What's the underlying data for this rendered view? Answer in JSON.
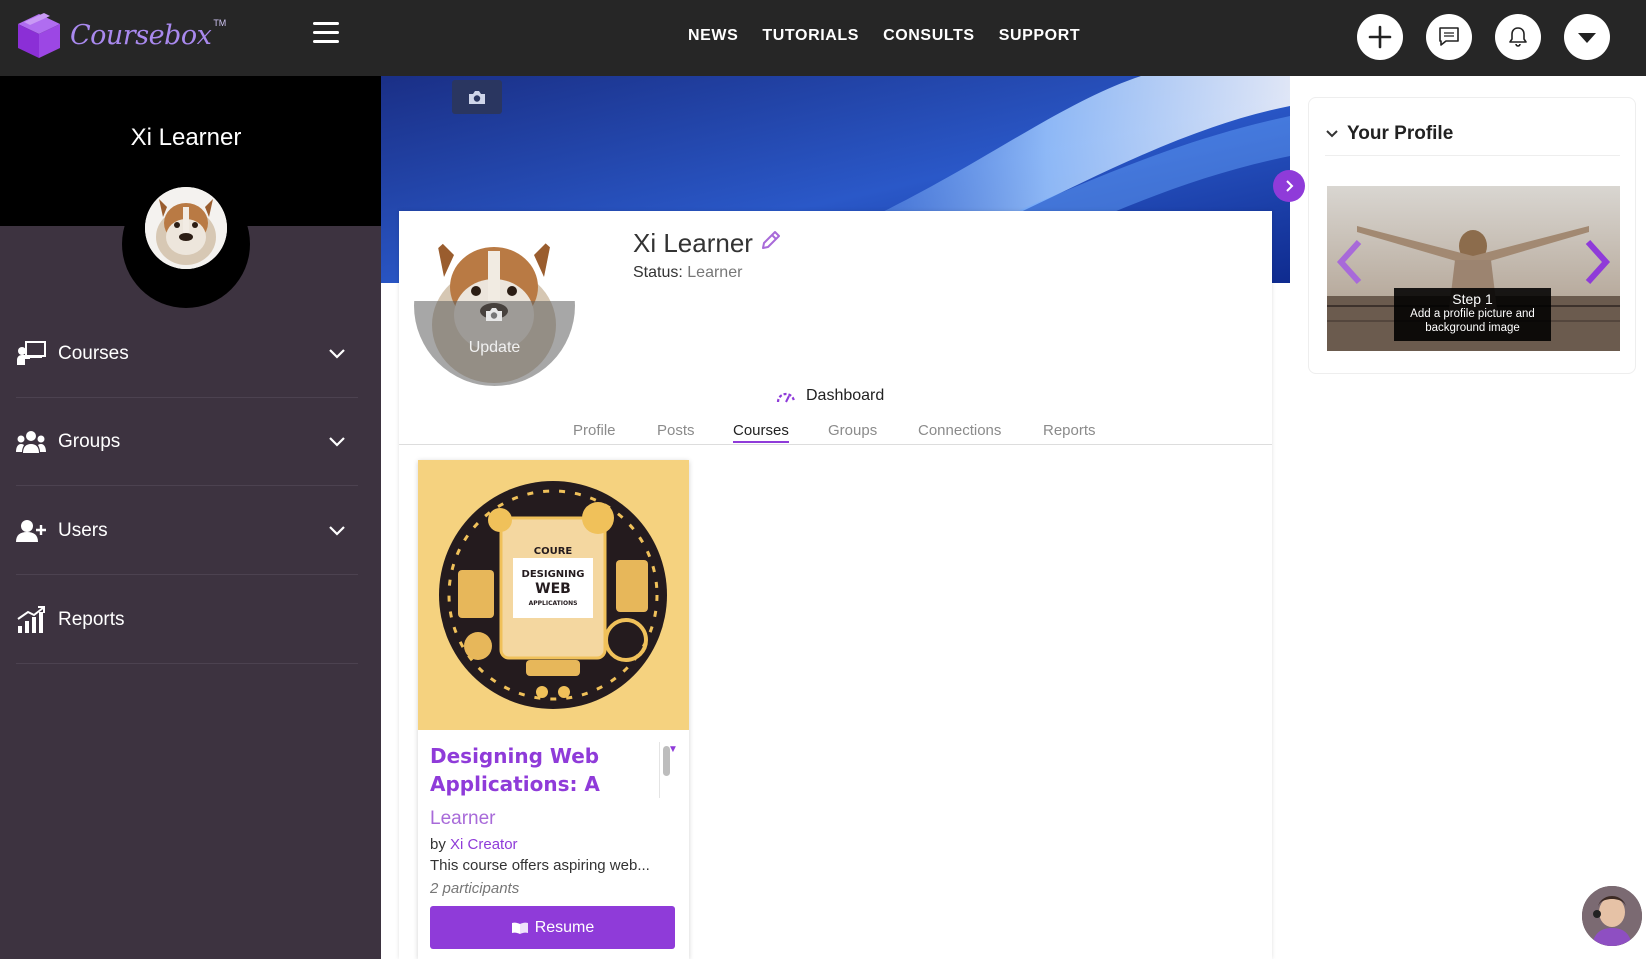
{
  "app": {
    "brand": "Coursebox",
    "trademark": "TM"
  },
  "topnav": {
    "items": [
      "NEWS",
      "TUTORIALS",
      "CONSULTS",
      "SUPPORT"
    ]
  },
  "header_icons": [
    "plus-icon",
    "chat-icon",
    "bell-icon",
    "dropdown-icon"
  ],
  "sidebar": {
    "user_name": "Xi Learner",
    "items": [
      {
        "label": "Courses",
        "icon": "courses-icon",
        "expandable": true
      },
      {
        "label": "Groups",
        "icon": "groups-icon",
        "expandable": true
      },
      {
        "label": "Users",
        "icon": "users-icon",
        "expandable": true
      },
      {
        "label": "Reports",
        "icon": "reports-icon",
        "expandable": false
      }
    ]
  },
  "profile": {
    "name": "Xi Learner",
    "status_label": "Status:",
    "status_value": "Learner",
    "photo_overlay": "Update"
  },
  "dashboard_label": "Dashboard",
  "tabs": [
    {
      "label": "Profile",
      "active": false
    },
    {
      "label": "Posts",
      "active": false
    },
    {
      "label": "Courses",
      "active": true
    },
    {
      "label": "Groups",
      "active": false
    },
    {
      "label": "Connections",
      "active": false
    },
    {
      "label": "Reports",
      "active": false
    }
  ],
  "course": {
    "image_text": [
      "COURE",
      "DESIGNING",
      "WEB",
      "APPLICATIONS"
    ],
    "title": "Designing Web Applications: A Short",
    "role": "Learner",
    "by_label": "by",
    "author": "Xi Creator",
    "description": "This course offers aspiring web...",
    "participants": "2 participants",
    "button_label": "Resume"
  },
  "right_panel": {
    "title": "Your Profile",
    "step_title": "Step 1",
    "step_text": "Add a profile picture and background image"
  },
  "colors": {
    "accent": "#8f3bd9",
    "topbar": "#262626",
    "sidebar": "#3d3340"
  }
}
